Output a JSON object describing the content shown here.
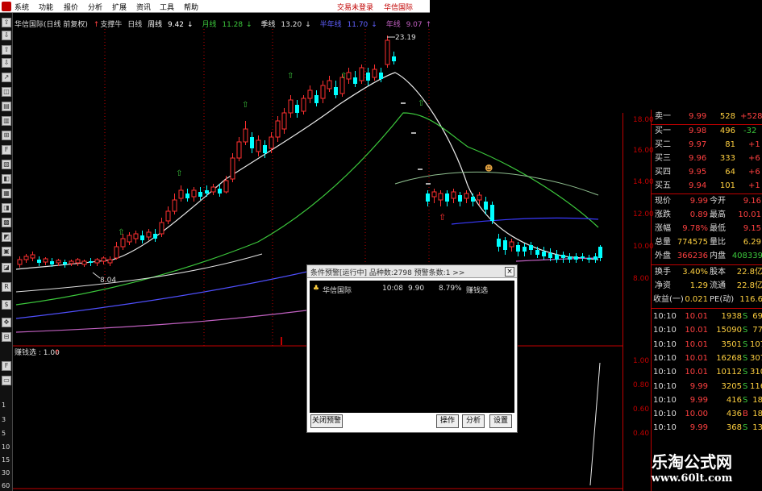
{
  "menu": {
    "items": [
      "系统",
      "功能",
      "报价",
      "分析",
      "扩展",
      "资讯",
      "工具",
      "帮助"
    ],
    "right_links": [
      "交易未登录",
      "华信国际"
    ]
  },
  "chart_header": {
    "stock_title": "华信国际(日线 前复权)",
    "indicator": "支撑牛",
    "period_label": "日线",
    "ma_items": [
      {
        "label": "周线",
        "value": "9.42",
        "arrow": "↓",
        "color": "#ffffff"
      },
      {
        "label": "月线",
        "value": "11.28",
        "arrow": "↓",
        "color": "#3cc83c"
      },
      {
        "label": "季线",
        "value": "13.20",
        "arrow": "↓",
        "color": "#e0e0e0"
      },
      {
        "label": "半年线",
        "value": "11.70",
        "arrow": "↓",
        "color": "#6060ff"
      },
      {
        "label": "年线",
        "value": "9.07",
        "arrow": "↑",
        "color": "#c060c0"
      }
    ]
  },
  "chart_annotations": {
    "high_label": "23.19",
    "low_label": "8.04"
  },
  "sub_indicator": {
    "label": "赚钱选 : 1.00",
    "arrow": "↑"
  },
  "left_ticks": [
    "1",
    "3",
    "5",
    "10",
    "15",
    "30",
    "60"
  ],
  "price_axis": {
    "main": [
      "18.00",
      "16.00",
      "14.00",
      "12.00",
      "10.00",
      "8.00"
    ],
    "sub": [
      "1.00",
      "0.80",
      "0.60",
      "0.40"
    ]
  },
  "quote": {
    "sell": [
      {
        "label": "卖一",
        "price": "9.99",
        "vol": "528",
        "chg": "+528"
      },
      {
        "label": "买一",
        "price": "9.98",
        "vol": "496",
        "chg": "-32"
      },
      {
        "label": "买二",
        "price": "9.97",
        "vol": "81",
        "chg": "+1"
      },
      {
        "label": "买三",
        "price": "9.96",
        "vol": "333",
        "chg": "+6"
      },
      {
        "label": "买四",
        "price": "9.95",
        "vol": "64",
        "chg": "+6"
      },
      {
        "label": "买五",
        "price": "9.94",
        "vol": "101",
        "chg": "+1"
      }
    ],
    "stats": [
      {
        "l1": "现价",
        "v1": "9.99",
        "l2": "今开",
        "v2": "9.16"
      },
      {
        "l1": "涨跌",
        "v1": "0.89",
        "l2": "最高",
        "v2": "10.01"
      },
      {
        "l1": "涨幅",
        "v1": "9.78%",
        "l2": "最低",
        "v2": "9.15"
      },
      {
        "l1": "总量",
        "v1": "774575",
        "l2": "量比",
        "v2": "6.29"
      },
      {
        "l1": "外盘",
        "v1": "366236",
        "l2": "内盘",
        "v2": "408339"
      }
    ],
    "info": [
      {
        "l1": "换手",
        "v1": "3.40%",
        "l2": "股本",
        "v2": "22.8亿"
      },
      {
        "l1": "净资",
        "v1": "1.29",
        "l2": "流通",
        "v2": "22.8亿"
      },
      {
        "l1": "收益(一)",
        "v1": "0.021",
        "l2": "PE(动)",
        "v2": "116.6"
      }
    ],
    "ticks": [
      {
        "time": "10:10",
        "price": "10.01",
        "vol": "1938",
        "side": "S",
        "n": "69"
      },
      {
        "time": "10:10",
        "price": "10.01",
        "vol": "15090",
        "side": "S",
        "n": "77"
      },
      {
        "time": "10:10",
        "price": "10.01",
        "vol": "3501",
        "side": "S",
        "n": "107"
      },
      {
        "time": "10:10",
        "price": "10.01",
        "vol": "16268",
        "side": "S",
        "n": "307"
      },
      {
        "time": "10:10",
        "price": "10.01",
        "vol": "10112",
        "side": "S",
        "n": "310"
      },
      {
        "time": "10:10",
        "price": "9.99",
        "vol": "3205",
        "side": "S",
        "n": "116"
      },
      {
        "time": "10:10",
        "price": "9.99",
        "vol": "416",
        "side": "S",
        "n": "18"
      },
      {
        "time": "10:10",
        "price": "10.00",
        "vol": "436",
        "side": "B",
        "n": "18"
      },
      {
        "time": "10:10",
        "price": "9.99",
        "vol": "368",
        "side": "S",
        "n": "13"
      }
    ]
  },
  "dialog": {
    "title": "条件预警[运行中] 品种数:2798 预警条数:1  >>",
    "close": "×",
    "row": {
      "name": "华信国际",
      "time": "10:08",
      "price": "9.90",
      "pct": "8.79%",
      "formula": "赚钱选"
    },
    "buttons": {
      "close_alert": "关闭预警",
      "operate": "操作",
      "analyze": "分析",
      "settings": "设置"
    }
  },
  "watermark": {
    "line1": "乐淘公式网",
    "line2": "www.60lt.com"
  }
}
